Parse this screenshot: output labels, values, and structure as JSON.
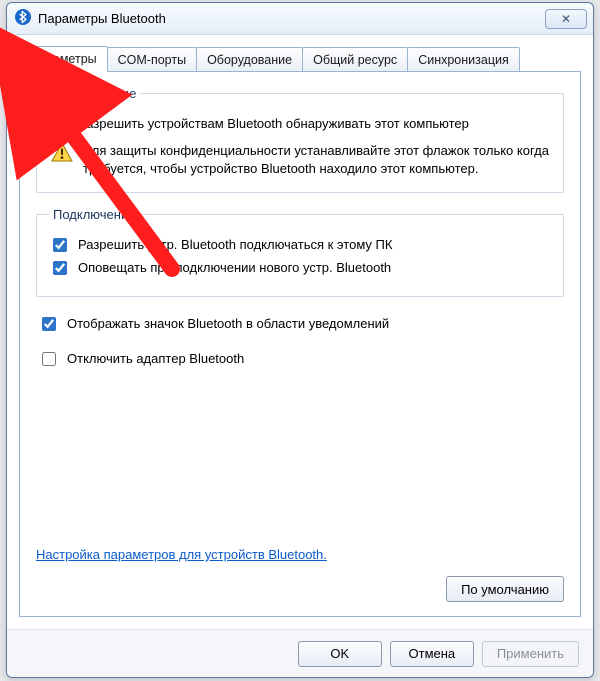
{
  "window": {
    "title": "Параметры Bluetooth",
    "close_glyph": "✕"
  },
  "tabs": [
    {
      "id": "params",
      "label": "Параметры",
      "active": true
    },
    {
      "id": "com",
      "label": "COM-порты",
      "active": false
    },
    {
      "id": "hw",
      "label": "Оборудование",
      "active": false
    },
    {
      "id": "share",
      "label": "Общий ресурс",
      "active": false
    },
    {
      "id": "sync",
      "label": "Синхронизация",
      "active": false
    }
  ],
  "groups": {
    "discovery": {
      "legend": "Обнаружение",
      "allow_discover": {
        "checked": true,
        "label": "Разрешить устройствам Bluetooth обнаруживать этот компьютер"
      },
      "warning": "Для защиты конфиденциальности устанавливайте этот флажок только когда требуется, чтобы устройство Bluetooth находило этот компьютер."
    },
    "connections": {
      "legend": "Подключения",
      "allow_connect": {
        "checked": true,
        "label": "Разрешить устр. Bluetooth подключаться к этому ПК"
      },
      "notify_new": {
        "checked": true,
        "label": "Оповещать при подключении нового устр. Bluetooth"
      }
    }
  },
  "misc": {
    "show_icon": {
      "checked": true,
      "label": "Отображать значок Bluetooth в области уведомлений"
    },
    "disable_adapter": {
      "checked": false,
      "label": "Отключить адаптер Bluetooth"
    }
  },
  "link": {
    "label": "Настройка параметров для устройств Bluetooth."
  },
  "buttons": {
    "defaults": "По умолчанию",
    "ok": "OK",
    "cancel": "Отмена",
    "apply": "Применить"
  },
  "colors": {
    "arrow": "#ff1e1e",
    "link": "#0a5bcb"
  }
}
